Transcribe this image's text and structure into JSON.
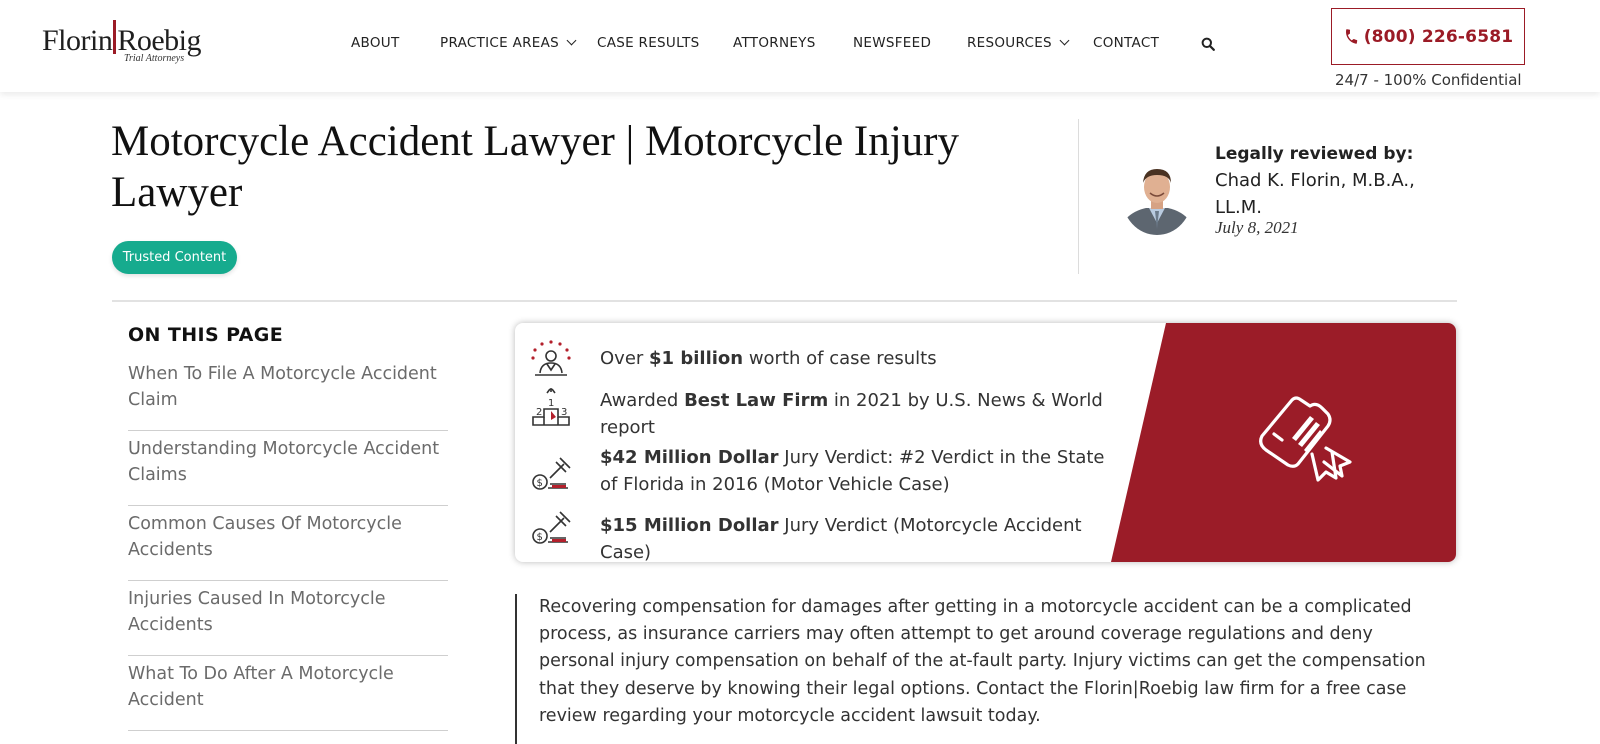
{
  "header": {
    "logo": {
      "name_left": "Florin",
      "name_right": "Roebig",
      "tagline": "Trial Attorneys"
    },
    "nav": [
      {
        "label": "ABOUT",
        "dropdown": false
      },
      {
        "label": "PRACTICE AREAS",
        "dropdown": true
      },
      {
        "label": "CASE RESULTS",
        "dropdown": false
      },
      {
        "label": "ATTORNEYS",
        "dropdown": false
      },
      {
        "label": "NEWSFEED",
        "dropdown": false
      },
      {
        "label": "RESOURCES",
        "dropdown": true
      },
      {
        "label": "CONTACT",
        "dropdown": false
      }
    ],
    "search_icon": "search-icon",
    "phone": "(800) 226-6581",
    "phone_icon": "phone-icon",
    "confidential": "24/7 - 100% Confidential"
  },
  "page": {
    "title": "Motorcycle Accident Lawyer | Motorcycle Injury Lawyer",
    "badge": "Trusted Content"
  },
  "review": {
    "label": "Legally reviewed by:",
    "reviewer": "Chad K. Florin, M.B.A., LL.M.",
    "date": "July 8, 2021"
  },
  "toc": {
    "title": "ON THIS PAGE",
    "items": [
      "When To File A Motorcycle Accident Claim",
      "Understanding Motorcycle Accident Claims",
      "Common Causes Of Motorcycle Accidents",
      "Injuries Caused In Motorcycle Accidents",
      "What To Do After A Motorcycle Accident"
    ]
  },
  "highlights": [
    {
      "icon": "client-stars-icon",
      "pre": "Over ",
      "bold": "$1 billion",
      "post": " worth of case results"
    },
    {
      "icon": "podium-icon",
      "pre": "Awarded ",
      "bold": "Best Law Firm",
      "post": " in 2021 by U.S. News & World report"
    },
    {
      "icon": "gavel-money-icon",
      "pre": "",
      "bold": "$42 Million Dollar",
      "post": " Jury Verdict: #2 Verdict in the State of Florida in 2016 (Motor Vehicle Case)"
    },
    {
      "icon": "gavel-money-icon",
      "pre": "",
      "bold": "$15 Million Dollar",
      "post": " Jury Verdict (Motorcycle Accident Case)"
    }
  ],
  "award_icon": "award-ribbon-icon",
  "colors": {
    "brand_red": "#9b1c28",
    "badge_green": "#16ab8e"
  },
  "intro": "Recovering compensation for damages after getting in a motorcycle accident can be a complicated process, as insurance carriers may often attempt to get around coverage regulations and deny personal injury compensation on behalf of the at-fault party. Injury victims can get the compensation that they deserve by knowing their legal options. Contact the Florin|Roebig law firm for a free case review regarding your motorcycle accident lawsuit today."
}
